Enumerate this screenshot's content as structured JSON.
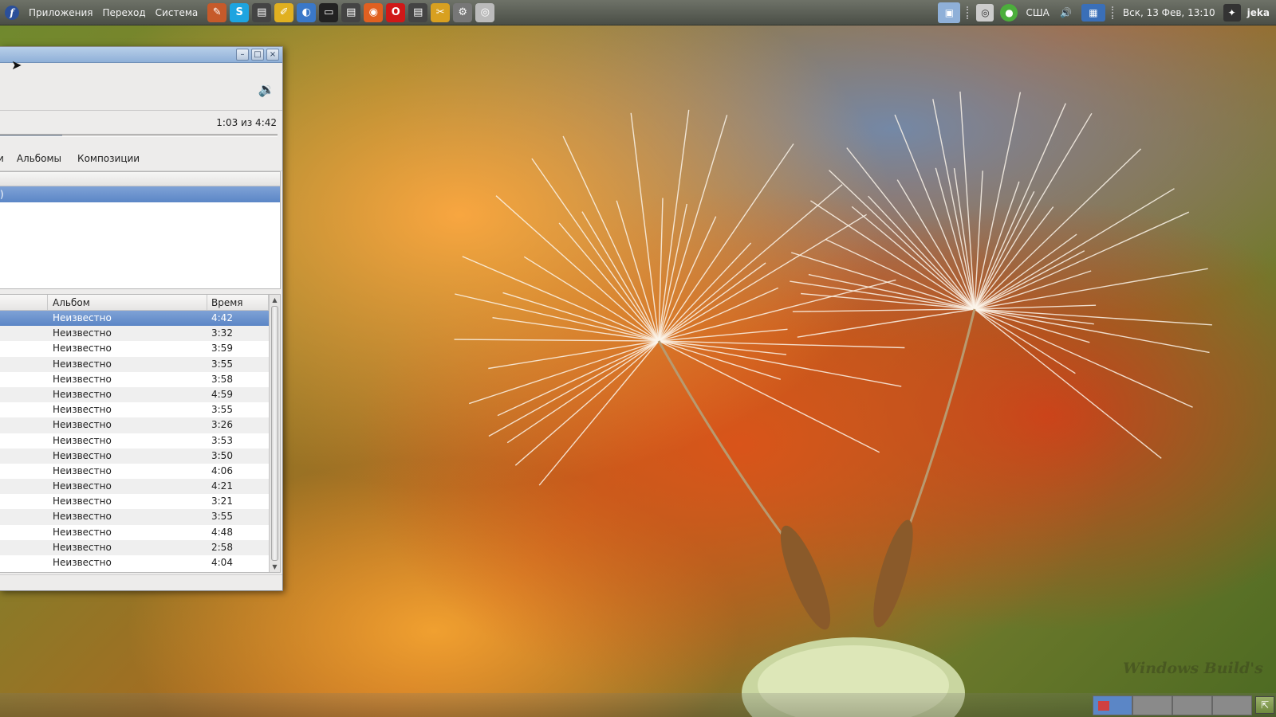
{
  "top_panel": {
    "menus": [
      "Приложения",
      "Переход",
      "Система"
    ],
    "launchers": [
      {
        "icon": "pencil-app-icon",
        "color": "#c65a2a",
        "glyph": "✎"
      },
      {
        "icon": "skype-icon",
        "color": "#1ea4e0",
        "glyph": "S"
      },
      {
        "icon": "film-editor-icon",
        "color": "#444444",
        "glyph": "▤"
      },
      {
        "icon": "notes-icon",
        "color": "#e0b020",
        "glyph": "✐"
      },
      {
        "icon": "web-browser-icon",
        "color": "#3a78c8",
        "glyph": "◐"
      },
      {
        "icon": "terminal-icon",
        "color": "#222222",
        "glyph": "▭"
      },
      {
        "icon": "video-icon",
        "color": "#444444",
        "glyph": "▤"
      },
      {
        "icon": "firefox-icon",
        "color": "#e06020",
        "glyph": "◉"
      },
      {
        "icon": "opera-icon",
        "color": "#d01818",
        "glyph": "O"
      },
      {
        "icon": "movie-maker-icon",
        "color": "#444444",
        "glyph": "▤"
      },
      {
        "icon": "paint-tools-icon",
        "color": "#d8a020",
        "glyph": "✂"
      },
      {
        "icon": "settings-gear-icon",
        "color": "#777777",
        "glyph": "⚙"
      },
      {
        "icon": "speaker-app-icon",
        "color": "#bbbbbb",
        "glyph": "◎"
      }
    ],
    "tray": {
      "keyboard_layout": "США",
      "clock": "Вск, 13 Фев, 13:10",
      "user": "jeka"
    }
  },
  "player": {
    "time_text": "1:03 из 4:42",
    "progress_fraction": 0.223,
    "tabs": [
      "и",
      "Альбомы",
      "Композиции"
    ],
    "browser_selected": ")",
    "columns": {
      "album": "Альбом",
      "time": "Время"
    },
    "tracks": [
      {
        "album": "Неизвестно",
        "time": "4:42",
        "selected": true
      },
      {
        "album": "Неизвестно",
        "time": "3:32"
      },
      {
        "album": "Неизвестно",
        "time": "3:59"
      },
      {
        "album": "Неизвестно",
        "time": "3:55"
      },
      {
        "album": "Неизвестно",
        "time": "3:58"
      },
      {
        "album": "Неизвестно",
        "time": "4:59"
      },
      {
        "album": "Неизвестно",
        "time": "3:55"
      },
      {
        "album": "Неизвестно",
        "time": "3:26"
      },
      {
        "album": "Неизвестно",
        "time": "3:53"
      },
      {
        "album": "Неизвестно",
        "time": "3:50"
      },
      {
        "album": "Неизвестно",
        "time": "4:06"
      },
      {
        "album": "Неизвестно",
        "time": "4:21"
      },
      {
        "album": "Неизвестно",
        "time": "3:21"
      },
      {
        "album": "Неизвестно",
        "time": "3:55"
      },
      {
        "album": "Неизвестно",
        "time": "4:48"
      },
      {
        "album": "Неизвестно",
        "time": "2:58"
      },
      {
        "album": "Неизвестно",
        "time": "4:04"
      }
    ]
  },
  "desktop": {
    "watermark": "Windows Build's"
  }
}
